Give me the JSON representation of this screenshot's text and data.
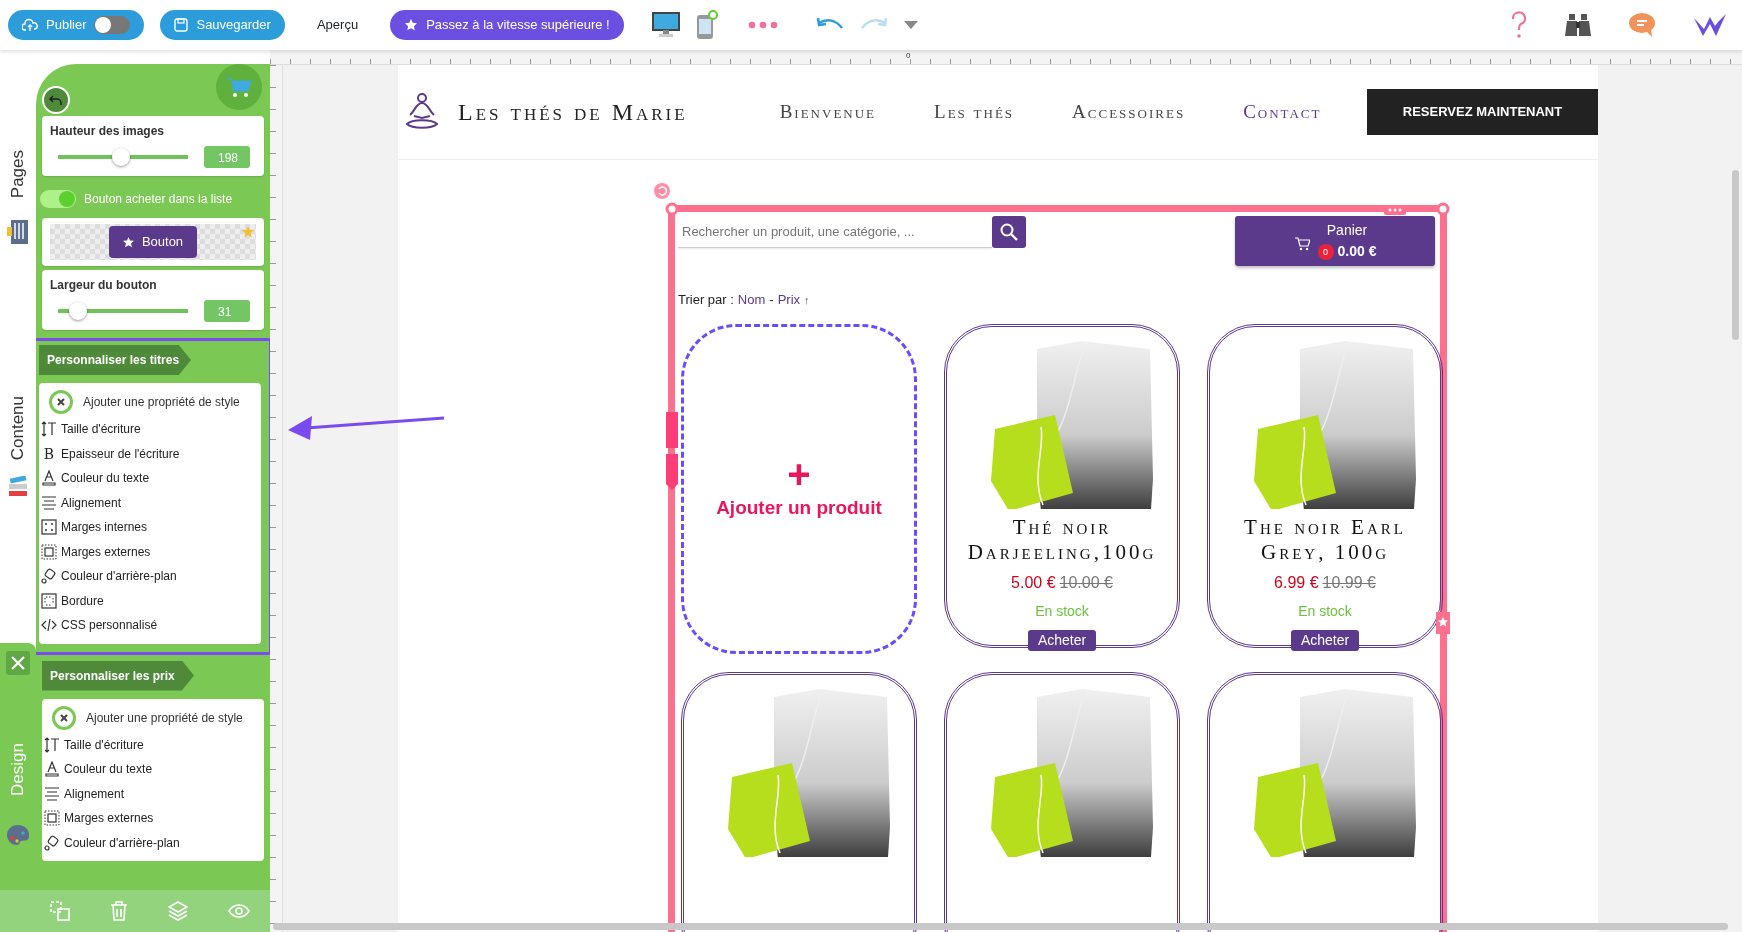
{
  "toolbar": {
    "publish": {
      "label": "Publier",
      "on": false
    },
    "save": "Sauvegarder",
    "preview": "Aperçu",
    "upgrade": "Passez à la vitesse supérieure !"
  },
  "side_tabs": [
    {
      "label": "Pages"
    },
    {
      "label": "Contenu"
    },
    {
      "label": "Design"
    }
  ],
  "panel": {
    "image_height": {
      "label": "Hauteur des images",
      "level": 0.48,
      "value": "198"
    },
    "buy_toggle": {
      "label": "Bouton acheter dans la liste",
      "on": true
    },
    "button_preview": {
      "label": "Bouton"
    },
    "button_width": {
      "label": "Largeur du bouton",
      "level": 0.1,
      "value": "31"
    },
    "sections": [
      {
        "title": "Personnaliser les titres",
        "highlighted": true,
        "add_label": "Ajouter une propriété de style",
        "properties": [
          {
            "kind": "size",
            "label": "Taille d'écriture"
          },
          {
            "kind": "weight",
            "icon_text": "B",
            "label": "Epaisseur de l'écriture"
          },
          {
            "kind": "color",
            "label": "Couleur du texte"
          },
          {
            "kind": "align",
            "label": "Alignement"
          },
          {
            "kind": "padding",
            "label": "Marges internes"
          },
          {
            "kind": "margin",
            "label": "Marges externes"
          },
          {
            "kind": "background",
            "label": "Couleur d'arrière-plan"
          },
          {
            "kind": "border",
            "label": "Bordure"
          },
          {
            "kind": "css",
            "label": "CSS personnalisé"
          }
        ]
      },
      {
        "title": "Personnaliser les prix",
        "highlighted": false,
        "add_label": "Ajouter une propriété de style",
        "properties": [
          {
            "kind": "size",
            "label": "Taille d'écriture"
          },
          {
            "kind": "color",
            "label": "Couleur du texte"
          },
          {
            "kind": "align",
            "label": "Alignement"
          },
          {
            "kind": "margin",
            "label": "Marges externes"
          },
          {
            "kind": "background",
            "label": "Couleur d'arrière-plan"
          }
        ]
      }
    ]
  },
  "ruler_zero": "0",
  "site": {
    "logo": "Les thés de Marie",
    "nav": [
      {
        "label": "Bienvenue",
        "selected": false
      },
      {
        "label": "Les thés",
        "selected": false
      },
      {
        "label": "Accessoires",
        "selected": false
      },
      {
        "label": "Contact",
        "selected": true
      }
    ],
    "cta": "RESERVEZ MAINTENANT"
  },
  "shop": {
    "search_placeholder": "Rechercher un produit, une catégorie, ...",
    "cart": {
      "label": "Panier",
      "count": "0",
      "total": "0.00 €"
    },
    "sort": {
      "label": "Trier par :",
      "options": [
        {
          "label": "Nom"
        },
        {
          "label": "Prix"
        }
      ],
      "separator": "-",
      "arrow": "↑"
    },
    "add_product": {
      "icon": "+",
      "label": "Ajouter un produit"
    },
    "products": [
      {
        "kind": "listing",
        "title": "Thé noir Darjeeling,100g",
        "price": "5.00 €",
        "old_price": "10.00 €",
        "stock": "En stock",
        "button": "Acheter"
      },
      {
        "kind": "listing",
        "title": "The noir Earl Grey, 100g",
        "price": "6.99 €",
        "old_price": "10.99 €",
        "stock": "En stock",
        "button": "Acheter"
      },
      {
        "kind": "cut"
      },
      {
        "kind": "cut"
      },
      {
        "kind": "cut"
      }
    ]
  }
}
